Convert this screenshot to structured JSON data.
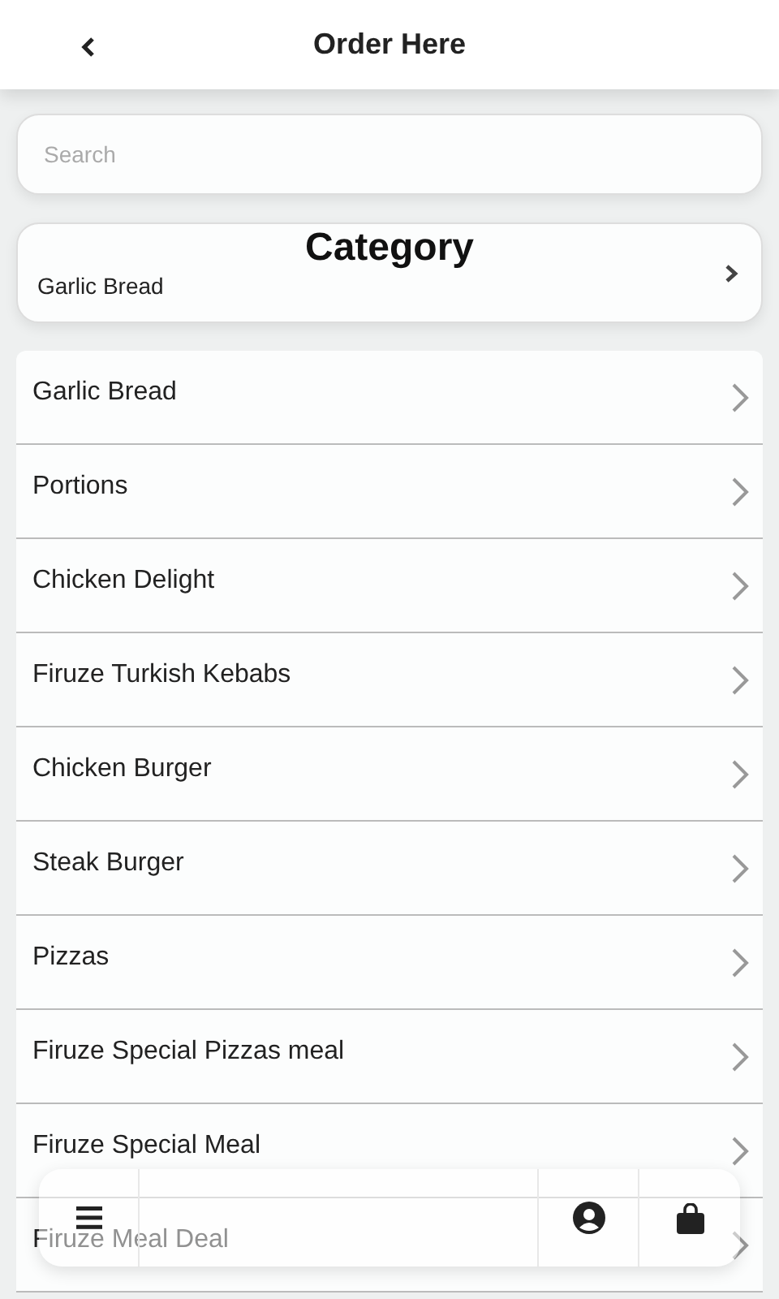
{
  "header": {
    "title": "Order Here"
  },
  "search": {
    "placeholder": "Search"
  },
  "category": {
    "title": "Category",
    "value": "Garlic Bread"
  },
  "items": [
    {
      "label": "Garlic Bread"
    },
    {
      "label": "Portions"
    },
    {
      "label": "Chicken Delight"
    },
    {
      "label": "Firuze Turkish Kebabs"
    },
    {
      "label": "Chicken Burger"
    },
    {
      "label": "Steak Burger"
    },
    {
      "label": "Pizzas"
    },
    {
      "label": "Firuze Special Pizzas meal"
    },
    {
      "label": "Firuze Special Meal"
    },
    {
      "label": "Firuze Meal Deal"
    }
  ]
}
